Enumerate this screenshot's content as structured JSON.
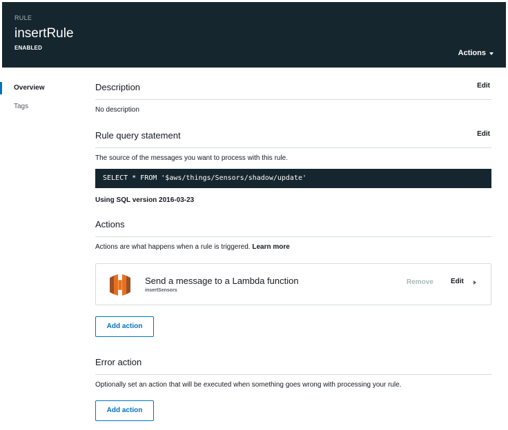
{
  "header": {
    "kicker": "RULE",
    "title": "insertRule",
    "status": "ENABLED",
    "actions_label": "Actions"
  },
  "sidenav": {
    "items": [
      {
        "label": "Overview",
        "active": true
      },
      {
        "label": "Tags",
        "active": false
      }
    ]
  },
  "description": {
    "heading": "Description",
    "edit_label": "Edit",
    "text": "No description"
  },
  "query": {
    "heading": "Rule query statement",
    "edit_label": "Edit",
    "help_text": "The source of the messages you want to process with this rule.",
    "sql": "SELECT * FROM '$aws/things/Sensors/shadow/update'",
    "sql_version": "Using SQL version 2016-03-23"
  },
  "actions": {
    "heading": "Actions",
    "help_text": "Actions are what happens when a rule is triggered.",
    "learn_more": "Learn more",
    "card": {
      "icon": "lambda-icon",
      "title": "Send a message to a Lambda function",
      "subtitle": "insertSensors",
      "remove_label": "Remove",
      "edit_label": "Edit"
    },
    "add_label": "Add action"
  },
  "error_action": {
    "heading": "Error action",
    "help_text": "Optionally set an action that will be executed when something goes wrong with processing your rule.",
    "add_label": "Add action"
  },
  "colors": {
    "header_bg": "#16262f",
    "accent": "#0073bb",
    "lambda_orange": "#e7701f"
  }
}
